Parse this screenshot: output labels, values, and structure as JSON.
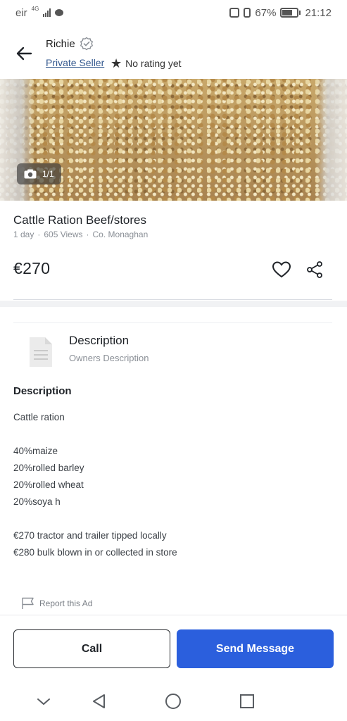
{
  "status_bar": {
    "carrier": "eir",
    "network": "4G",
    "battery_percent": "67%",
    "battery_level": 0.67,
    "time": "21:12"
  },
  "header": {
    "seller_name": "Richie",
    "seller_type": "Private Seller",
    "rating_text": "No rating yet"
  },
  "photo": {
    "counter": "1/1"
  },
  "listing": {
    "title": "Cattle Ration Beef/stores",
    "age": "1 day",
    "views": "605 Views",
    "location": "Co. Monaghan",
    "separator": "·",
    "price": "€270"
  },
  "description_header": {
    "title": "Description",
    "subtitle": "Owners Description"
  },
  "description": {
    "heading": "Description",
    "lines": [
      "Cattle ration",
      "",
      "40%maize",
      "20%rolled barley",
      "20%rolled wheat",
      "20%soya h",
      "",
      "€270 tractor and trailer tipped locally",
      "€280 bulk blown in or collected in store"
    ]
  },
  "report": {
    "label": "Report this Ad"
  },
  "actions": {
    "call_label": "Call",
    "message_label": "Send Message"
  },
  "colors": {
    "accent": "#2b5fdd",
    "link": "#34598f",
    "muted": "#8a8f96"
  },
  "icons": [
    "back-arrow-icon",
    "verified-icon",
    "star-icon",
    "camera-icon",
    "heart-icon",
    "share-icon",
    "document-icon",
    "flag-icon",
    "nav-down-icon",
    "nav-back-icon",
    "nav-home-icon",
    "nav-recents-icon"
  ]
}
